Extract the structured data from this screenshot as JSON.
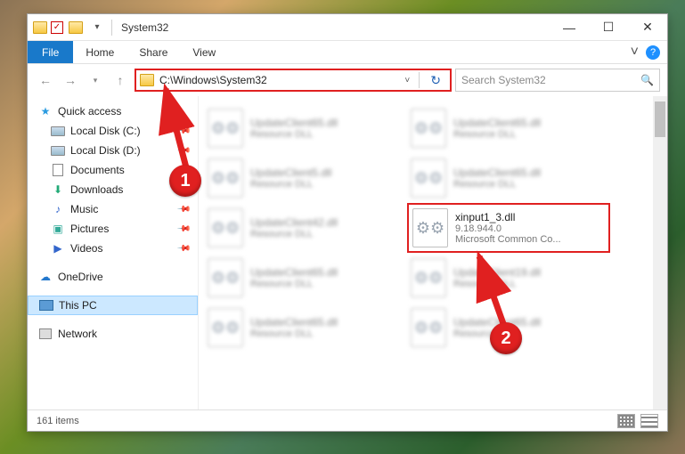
{
  "window": {
    "title": "System32"
  },
  "ribbon": {
    "file": "File",
    "tabs": [
      "Home",
      "Share",
      "View"
    ]
  },
  "address": {
    "path": "C:\\Windows\\System32"
  },
  "search": {
    "placeholder": "Search System32"
  },
  "nav": {
    "quick_access": "Quick access",
    "items": [
      {
        "label": "Local Disk (C:)",
        "icon": "disk",
        "pinned": true
      },
      {
        "label": "Local Disk (D:)",
        "icon": "disk",
        "pinned": true
      },
      {
        "label": "Documents",
        "icon": "doc",
        "pinned": true
      },
      {
        "label": "Downloads",
        "icon": "dl",
        "pinned": true
      },
      {
        "label": "Music",
        "icon": "music",
        "pinned": true
      },
      {
        "label": "Pictures",
        "icon": "pic",
        "pinned": true
      },
      {
        "label": "Videos",
        "icon": "vid",
        "pinned": true
      }
    ],
    "onedrive": "OneDrive",
    "thispc": "This PC",
    "network": "Network"
  },
  "files": [
    {
      "name": "UpdateClient65.dll",
      "desc": "Resource DLL",
      "blur": true
    },
    {
      "name": "UpdateClient65.dll",
      "desc": "Resource DLL",
      "blur": true
    },
    {
      "name": "UpdateClient5.dll",
      "desc": "Resource DLL",
      "blur": true
    },
    {
      "name": "UpdateClient65.dll",
      "desc": "Resource DLL",
      "blur": true
    },
    {
      "name": "UpdateClient42.dll",
      "desc": "Resource DLL",
      "blur": true
    },
    {
      "name": "xinput1_3.dll",
      "desc": "9.18.944.0",
      "desc2": "Microsoft Common Co...",
      "blur": false,
      "highlight": true
    },
    {
      "name": "UpdateClient65.dll",
      "desc": "Resource DLL",
      "blur": true
    },
    {
      "name": "UpdateClient19.dll",
      "desc": "Resource DLL",
      "blur": true
    },
    {
      "name": "UpdateClient65.dll",
      "desc": "Resource DLL",
      "blur": true
    },
    {
      "name": "UpdateClient65.dll",
      "desc": "Resource DLL",
      "blur": true
    }
  ],
  "status": {
    "count": "161 items"
  },
  "annotations": {
    "a1": "1",
    "a2": "2"
  }
}
